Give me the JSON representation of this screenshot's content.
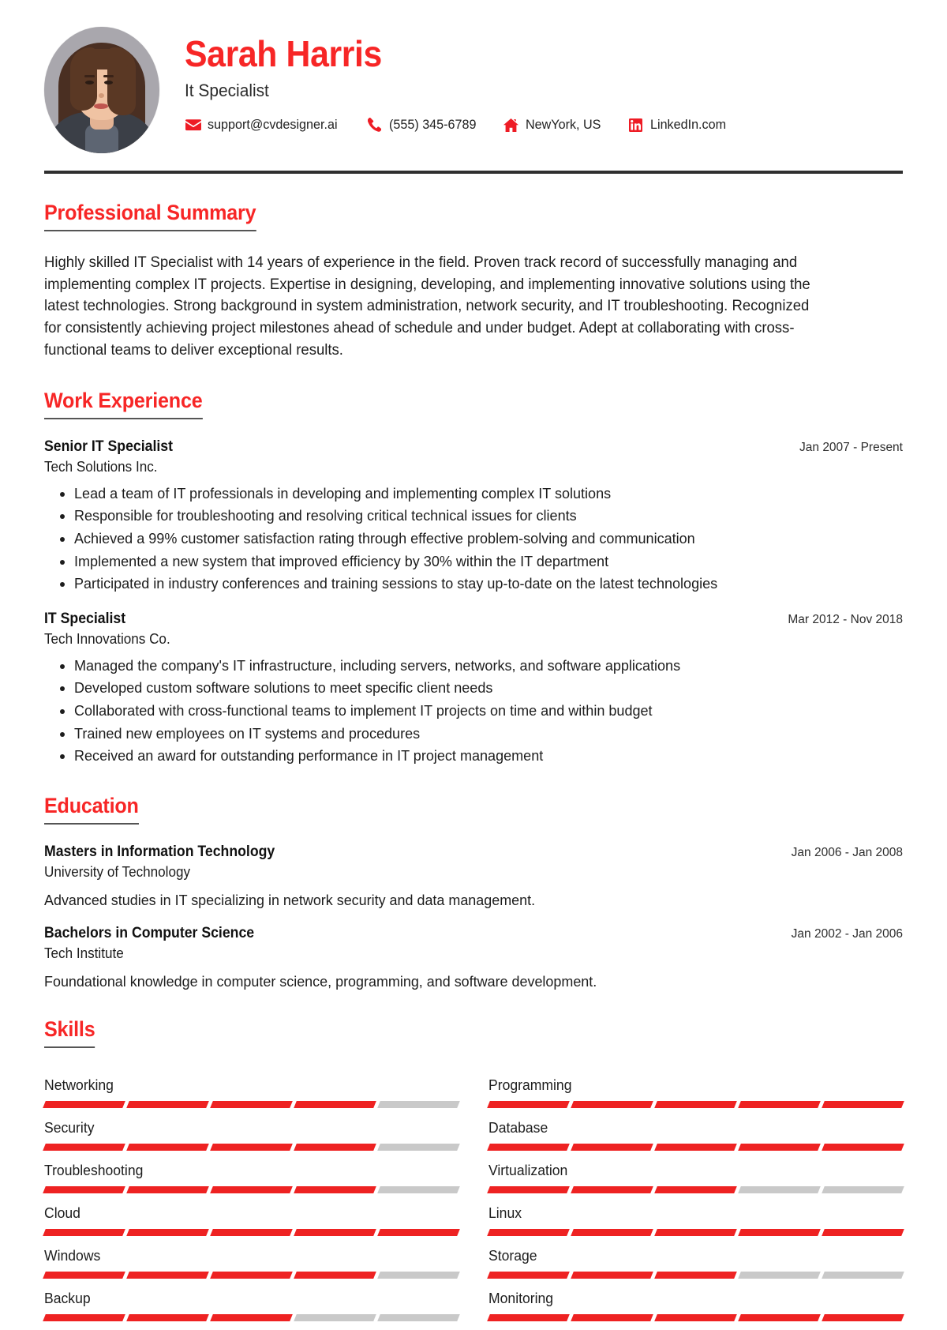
{
  "theme": {
    "accent": "#f72626",
    "bar_on": "#ee2222",
    "bar_off": "#c9c9c9",
    "rule": "#2f2f2f"
  },
  "header": {
    "name": "Sarah Harris",
    "job_title": "It Specialist",
    "avatar_alt": "profile-photo",
    "contacts": [
      {
        "icon": "envelope-icon",
        "text": "support@cvdesigner.ai"
      },
      {
        "icon": "phone-icon",
        "text": "(555) 345-6789"
      },
      {
        "icon": "home-icon",
        "text": "NewYork, US"
      },
      {
        "icon": "linkedin-icon",
        "text": "LinkedIn.com"
      }
    ]
  },
  "sections": {
    "summary": {
      "title": "Professional Summary",
      "text": "Highly skilled IT Specialist with 14 years of experience in the field. Proven track record of successfully managing and implementing complex IT projects. Expertise in designing, developing, and implementing innovative solutions using the latest technologies. Strong background in system administration, network security, and IT troubleshooting. Recognized for consistently achieving project milestones ahead of schedule and under budget. Adept at collaborating with cross-functional teams to deliver exceptional results."
    },
    "work": {
      "title": "Work Experience",
      "entries": [
        {
          "title": "Senior IT Specialist",
          "organization": "Tech Solutions Inc.",
          "date": "Jan 2007 - Present",
          "bullets": [
            "Lead a team of IT professionals in developing and implementing complex IT solutions",
            "Responsible for troubleshooting and resolving critical technical issues for clients",
            "Achieved a 99% customer satisfaction rating through effective problem-solving and communication",
            "Implemented a new system that improved efficiency by 30% within the IT department",
            "Participated in industry conferences and training sessions to stay up-to-date on the latest technologies"
          ]
        },
        {
          "title": "IT Specialist",
          "organization": "Tech Innovations Co.",
          "date": "Mar 2012 - Nov 2018",
          "bullets": [
            "Managed the company's IT infrastructure, including servers, networks, and software applications",
            "Developed custom software solutions to meet specific client needs",
            "Collaborated with cross-functional teams to implement IT projects on time and within budget",
            "Trained new employees on IT systems and procedures",
            "Received an award for outstanding performance in IT project management"
          ]
        }
      ]
    },
    "education": {
      "title": "Education",
      "entries": [
        {
          "title": "Masters in Information Technology",
          "organization": "University of Technology",
          "date": "Jan 2006 - Jan 2008",
          "description": "Advanced studies in IT specializing in network security and data management."
        },
        {
          "title": "Bachelors in Computer Science",
          "organization": "Tech Institute",
          "date": "Jan 2002 - Jan 2006",
          "description": "Foundational knowledge in computer science, programming, and software development."
        }
      ]
    },
    "skills": {
      "title": "Skills",
      "max_level": 5,
      "items": [
        {
          "name": "Networking",
          "level": 4
        },
        {
          "name": "Programming",
          "level": 5
        },
        {
          "name": "Security",
          "level": 4
        },
        {
          "name": "Database",
          "level": 5
        },
        {
          "name": "Troubleshooting",
          "level": 4
        },
        {
          "name": "Virtualization",
          "level": 3
        },
        {
          "name": "Cloud",
          "level": 5
        },
        {
          "name": "Linux",
          "level": 5
        },
        {
          "name": "Windows",
          "level": 4
        },
        {
          "name": "Storage",
          "level": 3
        },
        {
          "name": "Backup",
          "level": 3
        },
        {
          "name": "Monitoring",
          "level": 5
        }
      ]
    }
  }
}
